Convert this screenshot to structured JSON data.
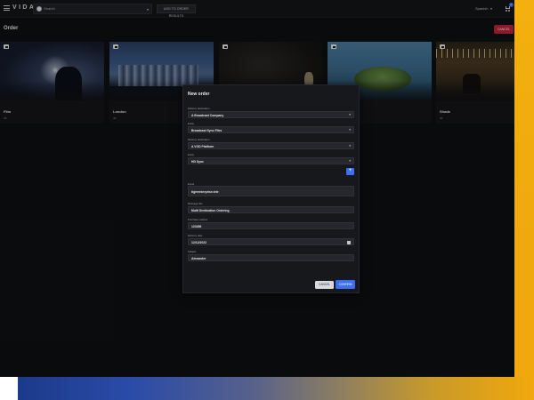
{
  "app": {
    "logo": "VIDA",
    "search": {
      "value": "Search",
      "caret": "▾"
    },
    "add_to_order_label": "ADD TO ORDER RESULTS",
    "language": "Spanish",
    "language_caret": "▾",
    "cart_count": "0"
  },
  "page": {
    "title": "Order",
    "cancel_label": "CANCEL"
  },
  "cards": [
    {
      "name": "Film",
      "resolution": "4K"
    },
    {
      "name": "London",
      "resolution": "4K"
    },
    {
      "name": "",
      "resolution": ""
    },
    {
      "name": "",
      "resolution": ""
    },
    {
      "name": "Shade",
      "resolution": "4K"
    }
  ],
  "modal": {
    "title": "New order",
    "fields": [
      {
        "label": "Delivery destination",
        "value": "A Broadcast Company",
        "caret": "▾"
      },
      {
        "label": "Entity",
        "value": "Broadcast Sync Files",
        "caret": "▾"
      },
      {
        "label": "Delivery destination",
        "value": "A VOD Platform",
        "caret": "▾"
      },
      {
        "label": "Entity",
        "value": "HD Sync",
        "caret": "▾"
      },
      {
        "label": "Email",
        "value": "tigerenterprise.tele"
      },
      {
        "label": "Message title",
        "value": "Multi Destination Ordering"
      },
      {
        "label": "Purchase method",
        "value": "123456"
      },
      {
        "label": "Delivery date",
        "value": "12/12/2022"
      },
      {
        "label": "Subject",
        "value": "Alexander"
      }
    ],
    "add_label": "+",
    "cancel_label": "CANCEL",
    "confirm_label": "CONFIRM"
  },
  "colors": {
    "accent": "#3d6ef5",
    "danger": "#c2233c",
    "background": "#0f1013",
    "gradient_start": "#1c3a8a",
    "gradient_end": "#f1a80c"
  }
}
